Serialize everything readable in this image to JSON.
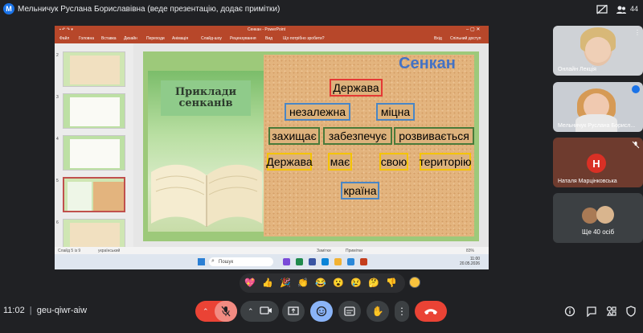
{
  "meeting": {
    "presenter_initial": "M",
    "presenter_title": "Мельничук Руслана Бориславівна (веде презентацію, додає примітки)",
    "participant_count": "44",
    "time": "11:02",
    "code": "geu-qiwr-aiw"
  },
  "ppt": {
    "window_title": "Сенкан - PowerPoint",
    "tabs": [
      "Файл",
      "Головна",
      "Вставка",
      "Дизайн",
      "Переходи",
      "Анімація",
      "Слайд-шоу",
      "Рецензування",
      "Вид"
    ],
    "tell_me": "Що потрібно зробити?",
    "sign_in": "Вхід",
    "share": "Спільний доступ",
    "thumb_numbers": [
      "2",
      "3",
      "4",
      "5",
      "6"
    ],
    "status_slide": "Слайд 5 із 9",
    "status_lang": "український",
    "status_notes": "Замітки",
    "status_comments": "Примітки",
    "zoom": "83%"
  },
  "slide": {
    "left_title": "Приклади сенканів",
    "heading": "Сенкан",
    "line1": "Держава",
    "line2a": "незалежна",
    "line2b": "міцна",
    "line3a": "захищає",
    "line3b": "забезпечує",
    "line3c": "розвивається",
    "line4a": "Держава",
    "line4b": "має",
    "line4c": "свою",
    "line4d": "територію",
    "line5": "країна"
  },
  "taskbar": {
    "search_placeholder": "Пошук",
    "clock_time": "11:00",
    "clock_date": "20.05.2026"
  },
  "participants": [
    {
      "name": "Онлайн Лекція"
    },
    {
      "name": "Мельничук Руслана Борисл..."
    },
    {
      "name": "Наталя Марцінковська",
      "initial": "Н"
    }
  ],
  "more_people": "Ще 40 осіб",
  "reactions": [
    "💖",
    "👍",
    "🎉",
    "👏",
    "😂",
    "😮",
    "😢",
    "🤔",
    "👎"
  ],
  "colors": {
    "meet_bg": "#202124",
    "ppt_accent": "#b7472a",
    "end_call": "#ea4335",
    "active_control": "#8ab4f8"
  }
}
